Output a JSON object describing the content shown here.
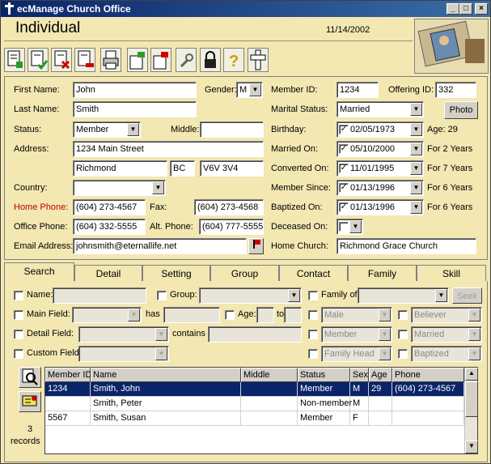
{
  "window": {
    "title": "ecManage Church Office"
  },
  "header": {
    "title": "Individual",
    "date": "11/14/2002"
  },
  "toolbar": {
    "icons": [
      "add-record-icon",
      "save-record-icon",
      "delete-record-icon",
      "remove-record-icon",
      "print-icon",
      "import-icon",
      "export-icon",
      "tools-icon",
      "lock-icon",
      "help-icon",
      "cross-icon"
    ]
  },
  "form": {
    "first_name_label": "First Name:",
    "first_name": "John",
    "gender_label": "Gender:",
    "gender": "M",
    "last_name_label": "Last Name:",
    "last_name": "Smith",
    "status_label": "Status:",
    "status": "Member",
    "middle_label": "Middle:",
    "middle": "",
    "address_label": "Address:",
    "address": "1234 Main Street",
    "city": "Richmond",
    "province": "BC",
    "postal": "V6V 3V4",
    "country_label": "Country:",
    "country": "",
    "home_phone_label": "Home Phone:",
    "home_phone": "(604) 273-4567",
    "fax_label": "Fax:",
    "fax": "(604) 273-4568",
    "office_phone_label": "Office Phone:",
    "office_phone": "(604) 332-5555",
    "alt_phone_label": "Alt. Phone:",
    "alt_phone": "(604) 777-5555",
    "email_label": "Email Address:",
    "email": "johnsmith@eternallife.net",
    "member_id_label": "Member ID:",
    "member_id": "1234",
    "offering_id_label": "Offering ID:",
    "offering_id": "332",
    "marital_label": "Marital Status:",
    "marital": "Married",
    "photo_button": "Photo",
    "birthday_label": "Birthday:",
    "birthday": "02/05/1973",
    "age_text": "Age: 29",
    "married_on_label": "Married On:",
    "married_on": "05/10/2000",
    "married_years": "For 2 Years",
    "converted_label": "Converted On:",
    "converted_on": "11/01/1995",
    "converted_years": "For 7 Years",
    "member_since_label": "Member Since:",
    "member_since": "01/13/1996",
    "member_years": "For 6 Years",
    "baptized_label": "Baptized On:",
    "baptized_on": "01/13/1996",
    "baptized_years": "For 6 Years",
    "deceased_label": "Deceased On:",
    "home_church_label": "Home Church:",
    "home_church": "Richmond Grace Church"
  },
  "tabs": [
    "Search",
    "Detail",
    "Setting",
    "Group",
    "Contact",
    "Family",
    "Skill"
  ],
  "search": {
    "name_label": "Name:",
    "group_label": "Group:",
    "family_label": "Family of:",
    "seek_button": "Seek",
    "main_field_label": "Main Field:",
    "has_label": "has",
    "age_label": "Age:",
    "to_label": "to",
    "male": "Male",
    "believer": "Believer",
    "detail_field_label": "Detail Field:",
    "contains_label": "contains",
    "member": "Member",
    "married": "Married",
    "custom_field_label": "Custom Field:",
    "family_head": "Family Head",
    "baptized": "Baptized"
  },
  "results": {
    "count_text": "3",
    "records_label": "records",
    "columns": [
      "Member ID",
      "Name",
      "Middle",
      "Status",
      "Sex",
      "Age",
      "Phone"
    ],
    "rows": [
      {
        "id": "1234",
        "name": "Smith, John",
        "middle": "",
        "status": "Member",
        "sex": "M",
        "age": "29",
        "phone": "(604) 273-4567"
      },
      {
        "id": "",
        "name": "Smith, Peter",
        "middle": "",
        "status": "Non-member",
        "sex": "M",
        "age": "",
        "phone": ""
      },
      {
        "id": "5567",
        "name": "Smith, Susan",
        "middle": "",
        "status": "Member",
        "sex": "F",
        "age": "",
        "phone": ""
      }
    ]
  }
}
